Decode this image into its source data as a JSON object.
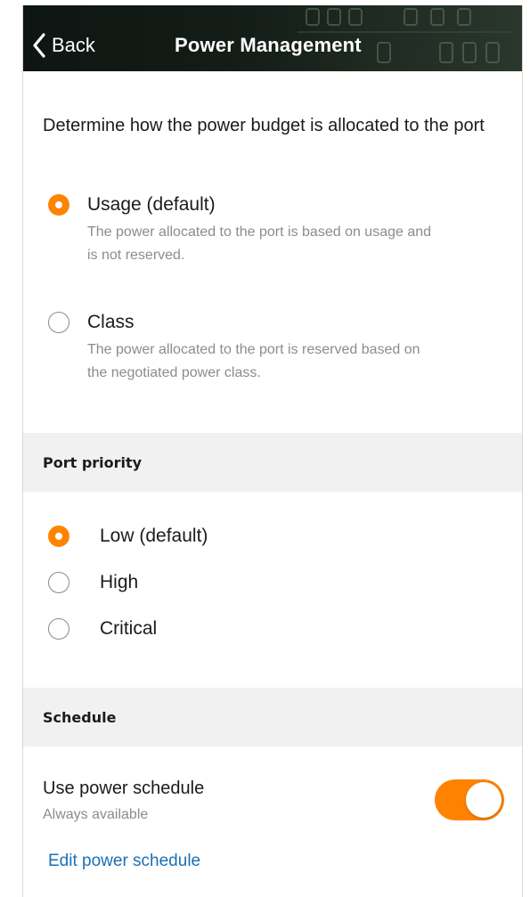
{
  "header": {
    "back_label": "Back",
    "title": "Power Management"
  },
  "allocation": {
    "intro": "Determine how the power budget is allocated to the port",
    "options": [
      {
        "label": "Usage (default)",
        "description": "The power allocated to the port is based on usage and is not reserved.",
        "selected": true
      },
      {
        "label": "Class",
        "description": "The power allocated to the port is reserved based on the negotiated power class.",
        "selected": false
      }
    ]
  },
  "port_priority": {
    "title": "Port priority",
    "options": [
      {
        "label": "Low (default)",
        "selected": true
      },
      {
        "label": "High",
        "selected": false
      },
      {
        "label": "Critical",
        "selected": false
      }
    ]
  },
  "schedule": {
    "title": "Schedule",
    "use_label": "Use power schedule",
    "use_sublabel": "Always available",
    "toggle_on": true,
    "edit_link": "Edit power schedule"
  },
  "colors": {
    "accent": "#ff8300",
    "link": "#1b6fb3"
  }
}
